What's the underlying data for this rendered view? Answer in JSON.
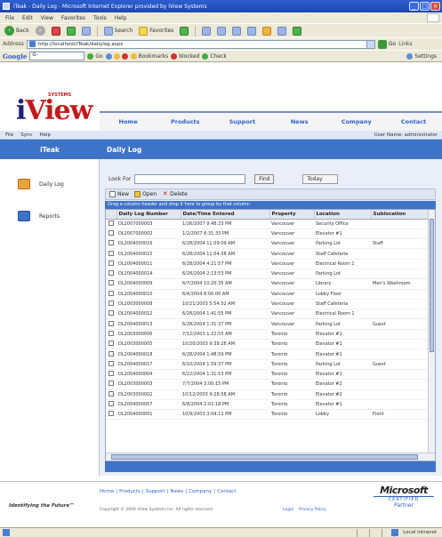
{
  "window": {
    "title": "iTeak - Daily Log - Microsoft Internet Explorer provided by iView Systems"
  },
  "browser": {
    "menu": [
      "File",
      "Edit",
      "View",
      "Favorites",
      "Tools",
      "Help"
    ],
    "toolbar": {
      "back": "Back",
      "search": "Search",
      "favorites": "Favorites"
    },
    "address_label": "Address",
    "address_value": "http://localhost/iTeak/dailylog.aspx",
    "go_label": "Go",
    "links_label": "Links",
    "google": {
      "logo": "Google",
      "search_value": "G-",
      "go_label": "Go",
      "bookmarks_label": "Bookmarks",
      "blocked_label": "blocked",
      "check_label": "Check",
      "settings_label": "Settings"
    }
  },
  "site": {
    "logo_prefix": "i",
    "logo_main": "View",
    "logo_sup": "SYSTEMS",
    "nav": [
      "Home",
      "Products",
      "Support",
      "News",
      "Company",
      "Contact"
    ],
    "subbar": [
      "File",
      "Sync",
      "Help"
    ],
    "user": "User Name: administrator"
  },
  "sidebar": {
    "header": "iTeak",
    "items": [
      {
        "label": "Daily Log",
        "icon": "daily-log-icon"
      },
      {
        "label": "Reports",
        "icon": "reports-icon"
      }
    ]
  },
  "main": {
    "header": "Daily Log",
    "search_label": "Look For",
    "search_value": "",
    "find_label": "Find",
    "filter_label": "Today",
    "toolbar": {
      "new": "New",
      "open": "Open",
      "delete": "Delete"
    },
    "group_hint": "Drag a column header and drop it here to group by that column",
    "columns": [
      "Daily Log Number",
      "Date/Time Entered",
      "Property",
      "Location",
      "Sublocation"
    ],
    "rows": [
      [
        "DL2007000003",
        "1/26/2007 9:48:33 PM",
        "Vancouver",
        "Security Office",
        ""
      ],
      [
        "DL2007000002",
        "1/2/2007 8:31:33 PM",
        "Vancouver",
        "Elevator #1",
        ""
      ],
      [
        "DL2004000016",
        "6/28/2004 11:09:09 AM",
        "Vancouver",
        "Parking Lot",
        "Staff"
      ],
      [
        "DL2004000015",
        "6/28/2004 11:04:58 AM",
        "Vancouver",
        "Staff Cafeteria",
        ""
      ],
      [
        "DL2004000011",
        "6/28/2004 4:21:57 PM",
        "Vancouver",
        "Electrical Room 1",
        ""
      ],
      [
        "DL2004000014",
        "6/28/2004 2:13:53 PM",
        "Vancouver",
        "Parking Lot",
        ""
      ],
      [
        "DL2004000009",
        "6/7/2004 10:20:35 AM",
        "Vancouver",
        "Library",
        "Men's Washroom"
      ],
      [
        "DL2004000010",
        "6/4/2004 8:00:00 AM",
        "Vancouver",
        "Lobby Floor",
        ""
      ],
      [
        "DL2003000008",
        "10/21/2003 5:54:52 AM",
        "Vancouver",
        "Staff Cafeteria",
        ""
      ],
      [
        "DL2004000012",
        "6/28/2004 1:41:55 PM",
        "Vancouver",
        "Electrical Room 1",
        ""
      ],
      [
        "DL2004000013",
        "6/28/2004 1:31:37 PM",
        "Vancouver",
        "Parking Lot",
        "Guest"
      ],
      [
        "DL2003000006",
        "7/12/2003 1:22:55 AM",
        "Toronto",
        "Elevator #1",
        ""
      ],
      [
        "DL2003000005",
        "10/20/2003 9:39:28 AM",
        "Toronto",
        "Elevator #1",
        ""
      ],
      [
        "DL2004000018",
        "6/28/2004 1:48:59 PM",
        "Toronto",
        "Elevator #1",
        ""
      ],
      [
        "DL2004000017",
        "6/10/2004 1:59:37 PM",
        "Toronto",
        "Parking Lot",
        "Guest"
      ],
      [
        "DL2004000004",
        "6/22/2004 1:31:53 PM",
        "Toronto",
        "Elevator #1",
        ""
      ],
      [
        "DL2003000003",
        "7/7/2004 3:00:15 PM",
        "Toronto",
        "Elevator #2",
        ""
      ],
      [
        "DL2003000002",
        "10/12/2003 9:28:58 AM",
        "Toronto",
        "Elevator #2",
        ""
      ],
      [
        "DL2004000007",
        "6/8/2004 2:02:18 PM",
        "Toronto",
        "Elevator #1",
        ""
      ],
      [
        "DL2004000001",
        "10/9/2003 3:04:12 PM",
        "Toronto",
        "Lobby",
        "Front"
      ]
    ]
  },
  "footer": {
    "links": [
      "Home",
      "Products",
      "Support",
      "News",
      "Company",
      "Contact"
    ],
    "copyright": "Copyright © 2004 iView Systems Inc. All rights reserved.",
    "legal": "Legal",
    "privacy": "Privacy Policy",
    "tagline": "Identifying the Future™",
    "ms_logo": "Microsoft",
    "ms_cert": "CERTIFIED",
    "ms_partner": "Partner"
  },
  "status": {
    "zone": "Local intranet"
  }
}
